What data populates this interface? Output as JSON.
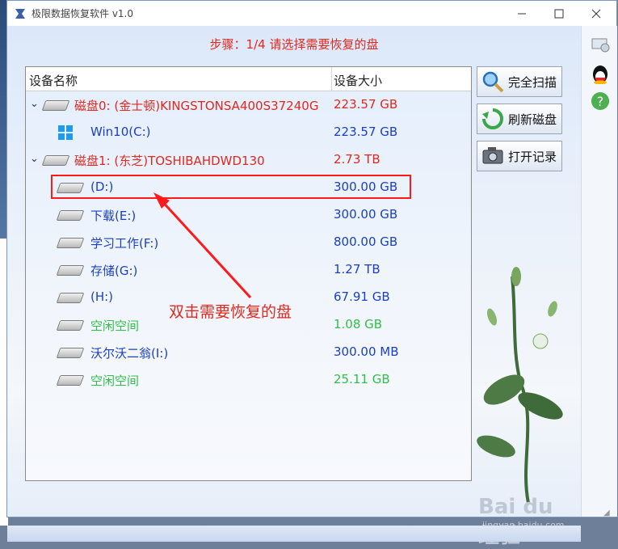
{
  "window": {
    "title": "极限数据恢复软件 v1.0"
  },
  "step": "步骤：1/4 请选择需要恢复的盘",
  "columns": {
    "name": "设备名称",
    "size": "设备大小"
  },
  "rows": [
    {
      "name": "磁盘0: (金士顿)KINGSTONSA400S37240G",
      "size": "223.57 GB",
      "color": "red",
      "level": 0,
      "icon": "drive-icon",
      "expand": "chevron-down-icon"
    },
    {
      "name": "Win10(C:)",
      "size": "223.57 GB",
      "color": "blue",
      "level": 1,
      "icon": "windows-icon"
    },
    {
      "name": "磁盘1: (东芝)TOSHIBAHDWD130",
      "size": "2.73 TB",
      "color": "red",
      "level": 0,
      "icon": "drive-icon",
      "expand": "chevron-down-icon"
    },
    {
      "name": "(D:)",
      "size": "300.00 GB",
      "color": "blue",
      "level": 1,
      "icon": "drive-icon"
    },
    {
      "name": "下载(E:)",
      "size": "300.00 GB",
      "color": "blue",
      "level": 1,
      "icon": "drive-icon"
    },
    {
      "name": "学习工作(F:)",
      "size": "800.00 GB",
      "color": "blue",
      "level": 1,
      "icon": "drive-icon"
    },
    {
      "name": "存储(G:)",
      "size": "1.27 TB",
      "color": "blue",
      "level": 1,
      "icon": "drive-icon"
    },
    {
      "name": "(H:)",
      "size": "67.91 GB",
      "color": "blue",
      "level": 1,
      "icon": "drive-icon"
    },
    {
      "name": "空闲空间",
      "size": "1.08 GB",
      "color": "green",
      "level": 1,
      "icon": "drive-icon"
    },
    {
      "name": "沃尔沃二翁(I:)",
      "size": "300.00 MB",
      "color": "blue",
      "level": 1,
      "icon": "drive-icon"
    },
    {
      "name": "空闲空间",
      "size": "25.11 GB",
      "color": "green",
      "level": 1,
      "icon": "drive-icon"
    }
  ],
  "buttons": {
    "full_scan": "完全扫描",
    "refresh": "刷新磁盘",
    "open_log": "打开记录"
  },
  "annotation": "双击需要恢复的盘",
  "watermark": {
    "main": "Bai du 经验",
    "sub": "jingyan.baidu.com"
  },
  "colors": {
    "red": "#e0281e",
    "blue": "#1a3fc6",
    "green": "#2fbf4a",
    "accent": "#ff1a1a"
  }
}
